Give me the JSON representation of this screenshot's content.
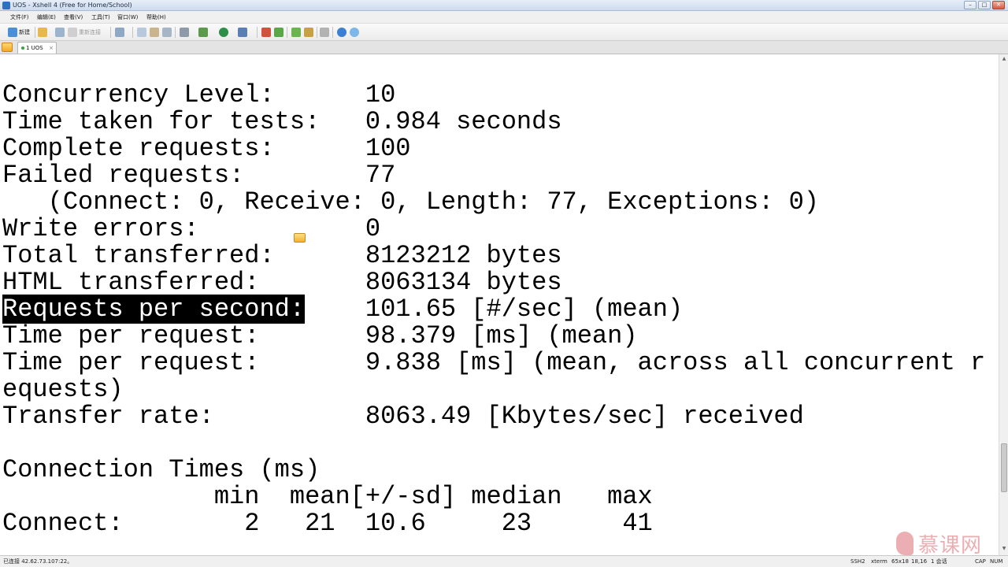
{
  "window": {
    "title": "UOS - Xshell 4 (Free for Home/School)",
    "controls": [
      "–",
      "□",
      "✕"
    ]
  },
  "menu": {
    "items": [
      "文件(F)",
      "编辑(E)",
      "查看(V)",
      "工具(T)",
      "窗口(W)",
      "帮助(H)"
    ]
  },
  "toolbar": {
    "new_label": "新建",
    "reconnect_label": "重新连接"
  },
  "tabs": [
    {
      "label": "1 UOS",
      "close": "×"
    }
  ],
  "terminal": {
    "lines": [
      "Concurrency Level:      10",
      "Time taken for tests:   0.984 seconds",
      "Complete requests:      100",
      "Failed requests:        77",
      "   (Connect: 0, Receive: 0, Length: 77, Exceptions: 0)",
      "Write errors:           0",
      "Total transferred:      8123212 bytes",
      "HTML transferred:       8063134 bytes",
      "Requests per second:",
      "Time per request:       98.379 [ms] (mean)",
      "Time per request:       9.838 [ms] (mean, across all concurrent r",
      "equests)",
      "Transfer rate:          8063.49 [Kbytes/sec] received",
      "",
      "Connection Times (ms)",
      "              min  mean[+/-sd] median   max",
      "Connect:        2   21  10.6     23      41"
    ],
    "highlighted_line_index": 8,
    "rps_label": "Requests per second:",
    "rps_value": "101.65 [#/sec] (mean)"
  },
  "statusbar": {
    "connection": "已连接 42.62.73.107:22。",
    "protocol": "SSH2",
    "term": "xterm",
    "size": "65x18",
    "cursor": "18,16",
    "sessions": "1 会话",
    "caps": "CAP",
    "num": "NUM"
  },
  "watermark": {
    "text": "慕课网"
  }
}
